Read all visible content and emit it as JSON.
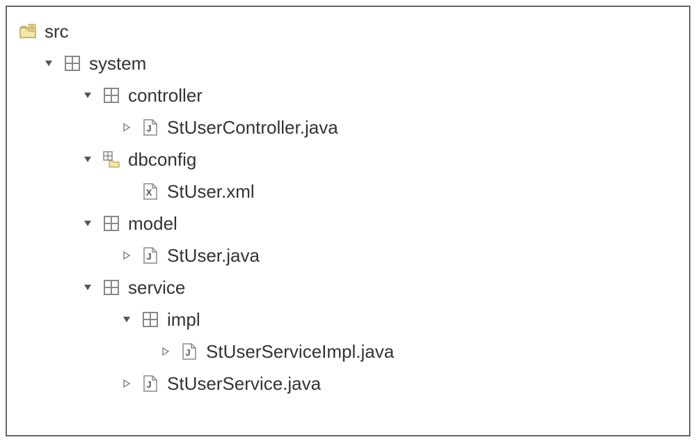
{
  "tree": {
    "src": {
      "label": "src"
    },
    "system": {
      "label": "system"
    },
    "controller": {
      "label": "controller"
    },
    "stUserController": {
      "label": "StUserController.java"
    },
    "dbconfig": {
      "label": "dbconfig"
    },
    "stUserXml": {
      "label": "StUser.xml"
    },
    "model": {
      "label": "model"
    },
    "stUserJava": {
      "label": "StUser.java"
    },
    "service": {
      "label": "service"
    },
    "impl": {
      "label": "impl"
    },
    "stUserServiceImpl": {
      "label": "StUserServiceImpl.java"
    },
    "stUserService": {
      "label": "StUserService.java"
    }
  }
}
